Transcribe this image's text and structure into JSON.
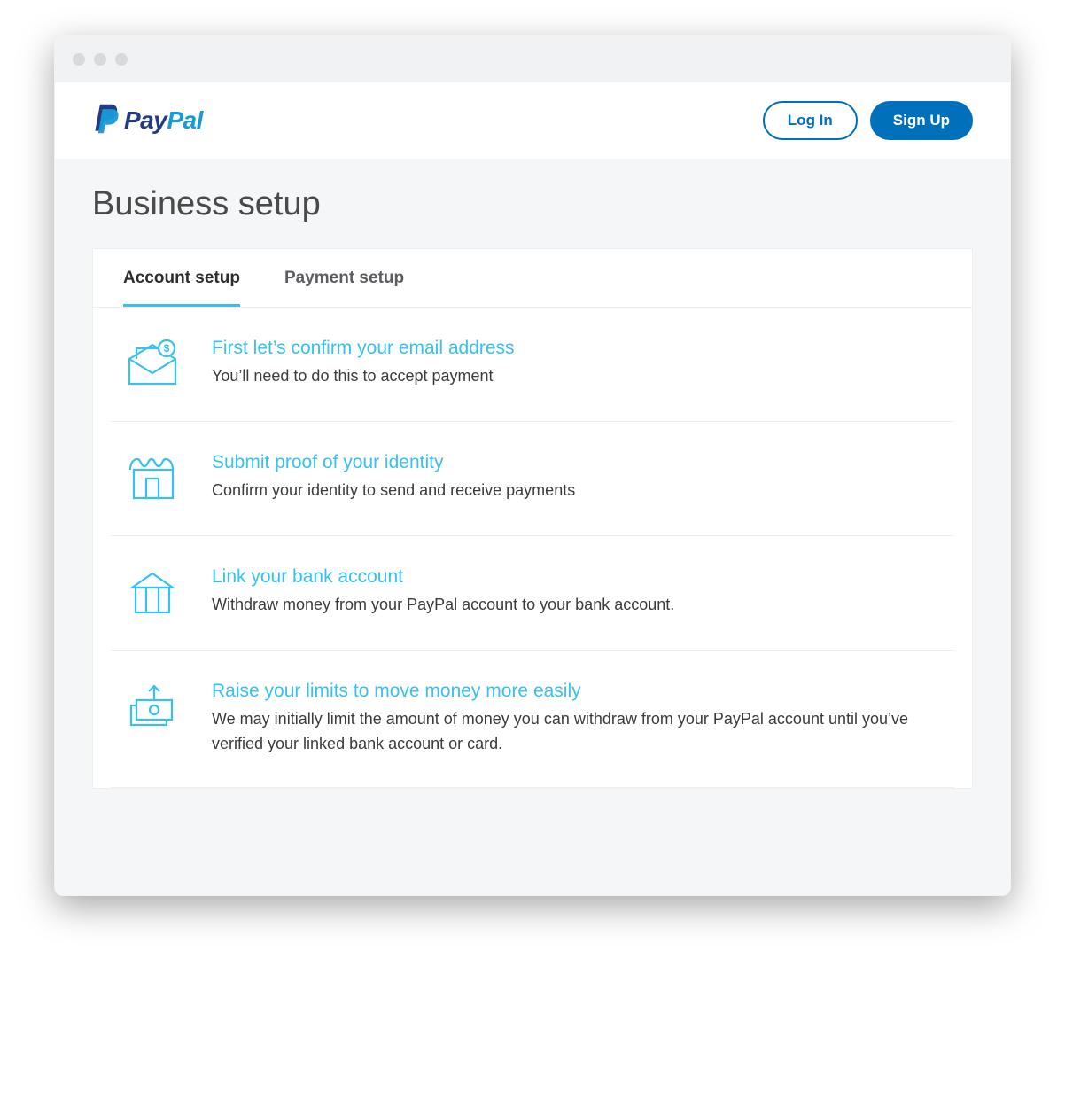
{
  "brand": {
    "name_part1": "Pay",
    "name_part2": "Pal"
  },
  "header": {
    "login_label": "Log In",
    "signup_label": "Sign Up"
  },
  "page": {
    "title": "Business setup"
  },
  "tabs": [
    {
      "label": "Account setup",
      "active": true
    },
    {
      "label": "Payment setup",
      "active": false
    }
  ],
  "steps": [
    {
      "icon": "email-dollar-icon",
      "title": "First let’s confirm your email address",
      "desc": "You’ll need to do this to accept payment"
    },
    {
      "icon": "storefront-icon",
      "title": "Submit proof of your identity",
      "desc": "Confirm your identity to send and receive payments"
    },
    {
      "icon": "bank-icon",
      "title": "Link your bank account",
      "desc": "Withdraw money from your PayPal account to your bank account."
    },
    {
      "icon": "raise-limit-icon",
      "title": "Raise your limits to move money more easily",
      "desc": "We may initially limit the amount of money you can withdraw from your PayPal account until you’ve verified your linked bank account or card."
    }
  ],
  "colors": {
    "accent": "#37c1f0",
    "primary_button": "#0070ba",
    "text_dark": "#2c2e2f"
  }
}
